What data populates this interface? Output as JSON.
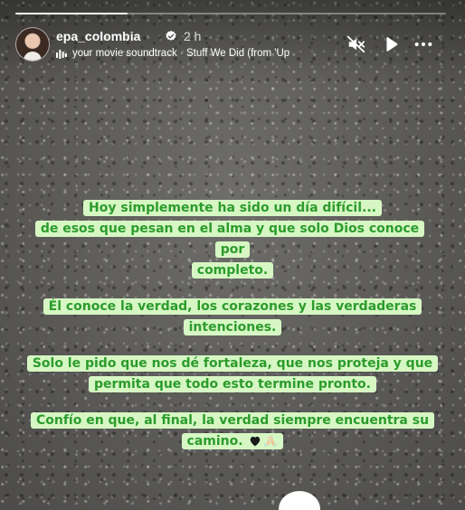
{
  "story": {
    "progress": 0.26,
    "user": {
      "username": "epa_colombia",
      "verified": true,
      "time_ago": "2 h"
    },
    "music": {
      "title": "your movie soundtrack",
      "separator": "·",
      "track": "Stuff We Did (from 'Up"
    },
    "controls": {
      "mute_icon": "speaker-muted-icon",
      "play_icon": "play-icon",
      "more_icon": "more-horizontal-icon"
    },
    "captions": [
      [
        "Hoy simplemente ha sido un día difícil...",
        "de esos que pesan en el alma y que solo Dios conoce por",
        "completo."
      ],
      [
        "Él conoce la verdad, los corazones y las verdaderas",
        "intenciones."
      ],
      [
        "Solo le pido que nos dé fortaleza, que nos proteja y que",
        "permita que todo esto termine pronto."
      ],
      [
        "Confío en que, al final, la verdad siempre encuentra su",
        "camino."
      ]
    ],
    "caption_emojis": [
      "black-heart-icon",
      "praying-hands-icon"
    ],
    "colors": {
      "caption_bg": "#d6f7c4",
      "caption_text": "#2c9b2c",
      "verified_badge": "#ffffff"
    }
  }
}
